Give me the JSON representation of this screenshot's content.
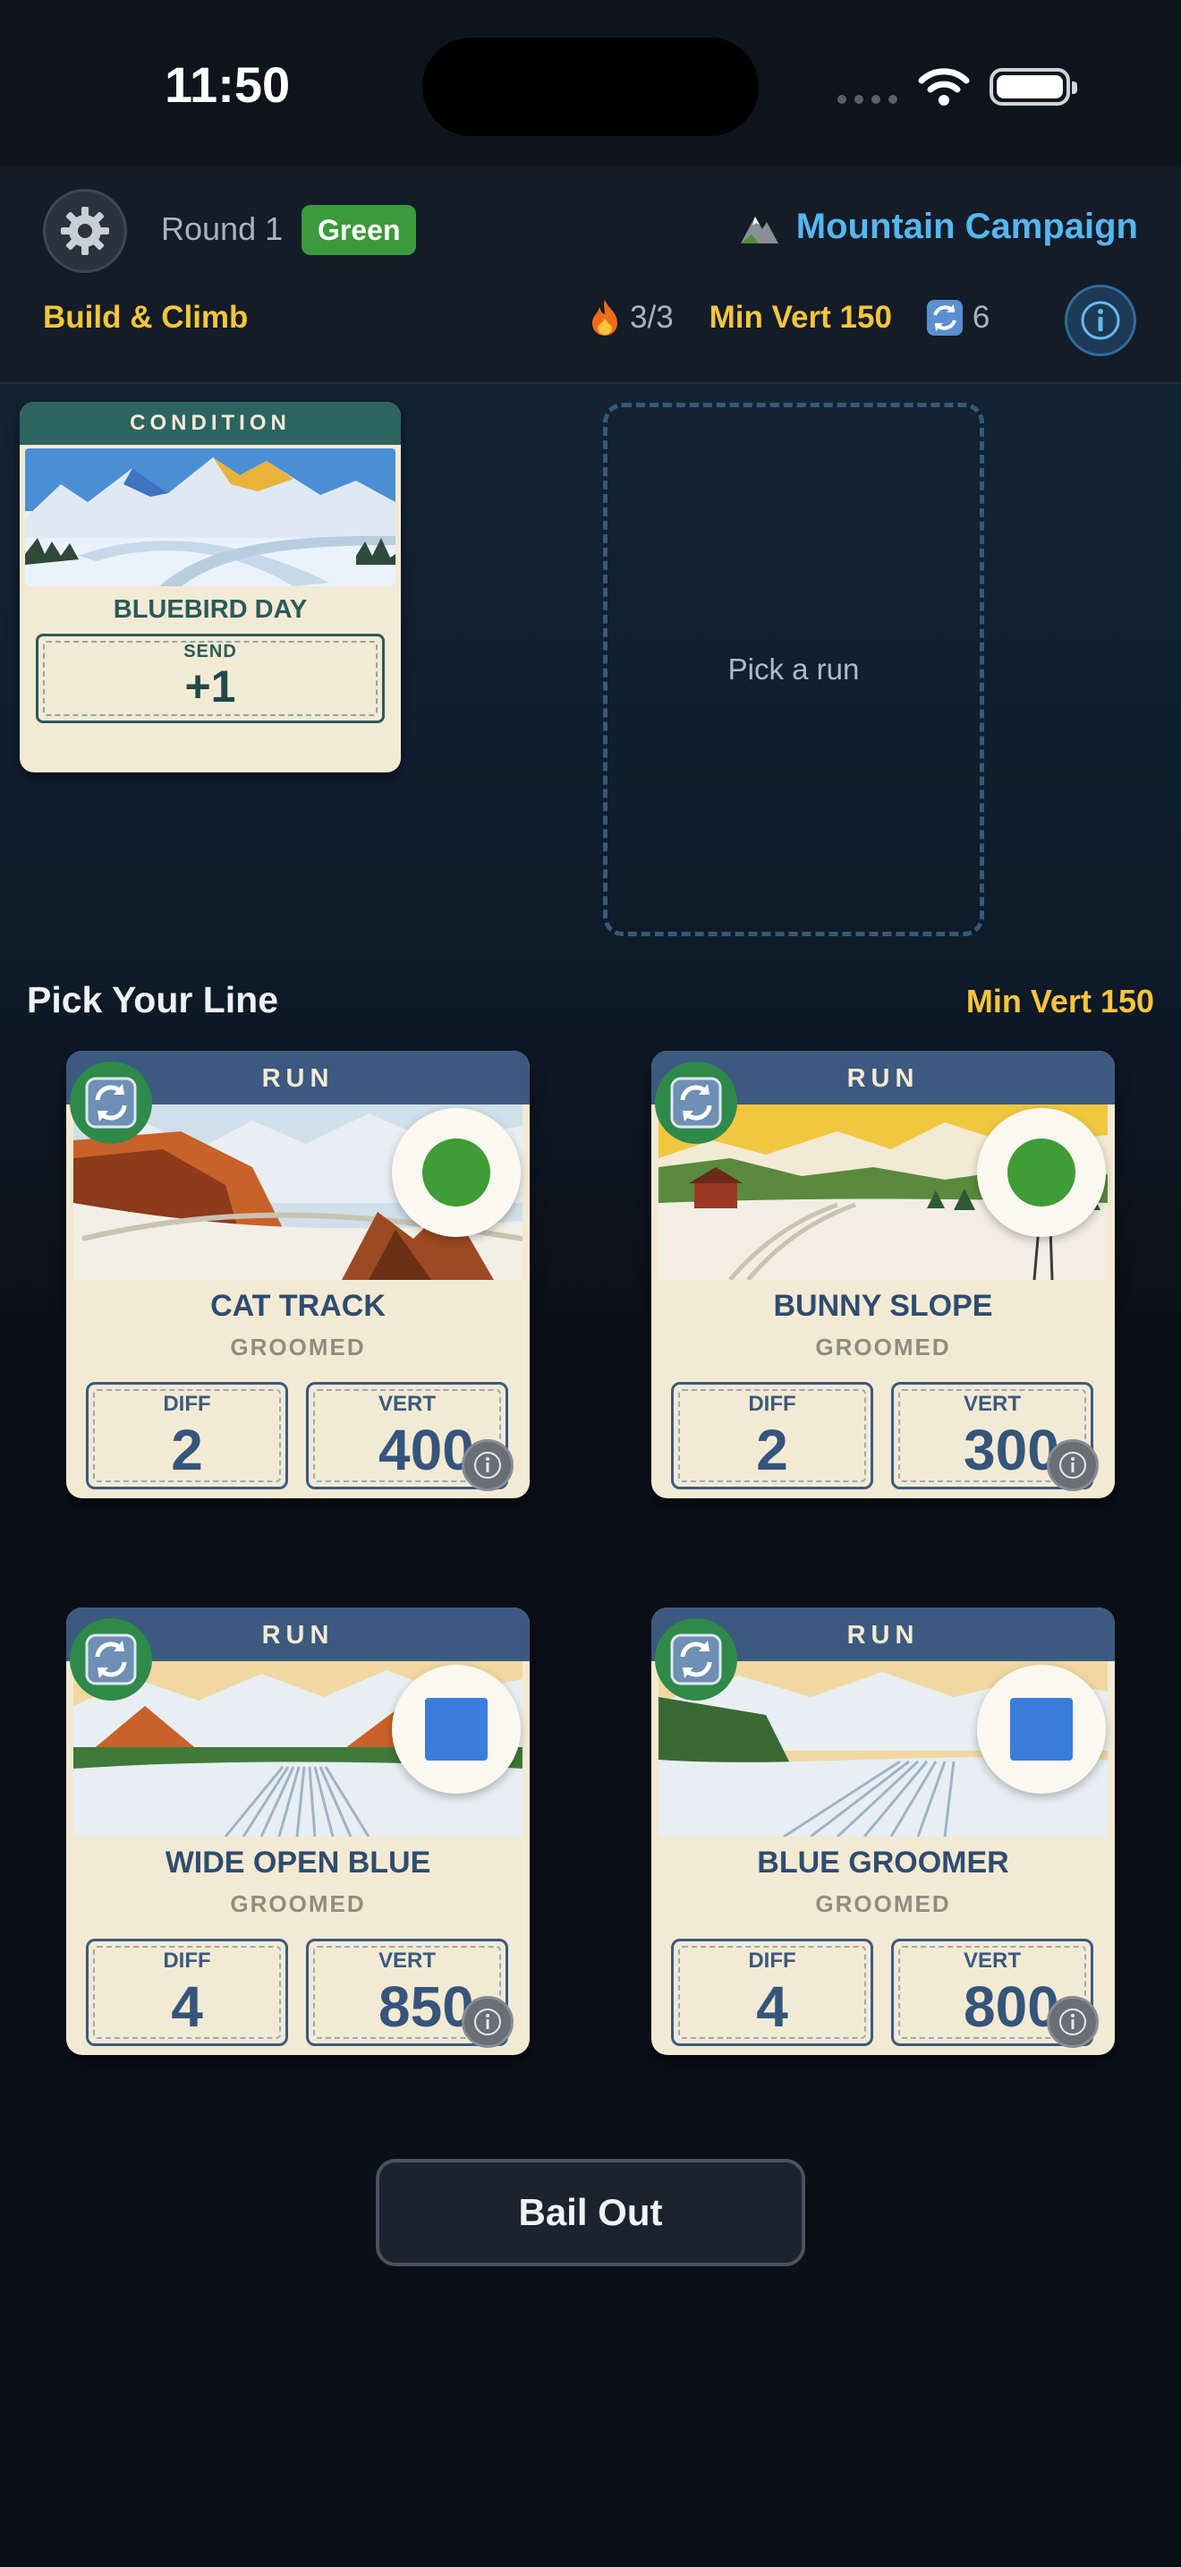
{
  "status_bar": {
    "time": "11:50"
  },
  "header": {
    "round_label": "Round 1",
    "difficulty_badge": "Green",
    "campaign_label": "Mountain Campaign",
    "mode_label": "Build & Climb",
    "energy": "3/3",
    "min_vert": "Min Vert 150",
    "swaps": "6"
  },
  "condition_card": {
    "header": "CONDITION",
    "name": "BLUEBIRD DAY",
    "stat_label": "SEND",
    "stat_value": "+1"
  },
  "drop_zone": {
    "label": "Pick a run"
  },
  "section": {
    "title": "Pick Your Line",
    "subtitle": "Min Vert 150"
  },
  "runs": [
    {
      "header": "RUN",
      "name": "CAT TRACK",
      "type": "GROOMED",
      "diff_label": "DIFF",
      "diff": "2",
      "vert_label": "VERT",
      "vert": "400",
      "marker": "green-circle"
    },
    {
      "header": "RUN",
      "name": "BUNNY SLOPE",
      "type": "GROOMED",
      "diff_label": "DIFF",
      "diff": "2",
      "vert_label": "VERT",
      "vert": "300",
      "marker": "green-circle"
    },
    {
      "header": "RUN",
      "name": "WIDE OPEN BLUE",
      "type": "GROOMED",
      "diff_label": "DIFF",
      "diff": "4",
      "vert_label": "VERT",
      "vert": "850",
      "marker": "blue-square"
    },
    {
      "header": "RUN",
      "name": "BLUE GROOMER",
      "type": "GROOMED",
      "diff_label": "DIFF",
      "diff": "4",
      "vert_label": "VERT",
      "vert": "800",
      "marker": "blue-square"
    }
  ],
  "footer": {
    "bail_label": "Bail Out"
  },
  "colors": {
    "accent_yellow": "#f5c53c",
    "accent_blue": "#55b6f0",
    "green": "#3f9c36",
    "blue": "#3b7ddb"
  }
}
